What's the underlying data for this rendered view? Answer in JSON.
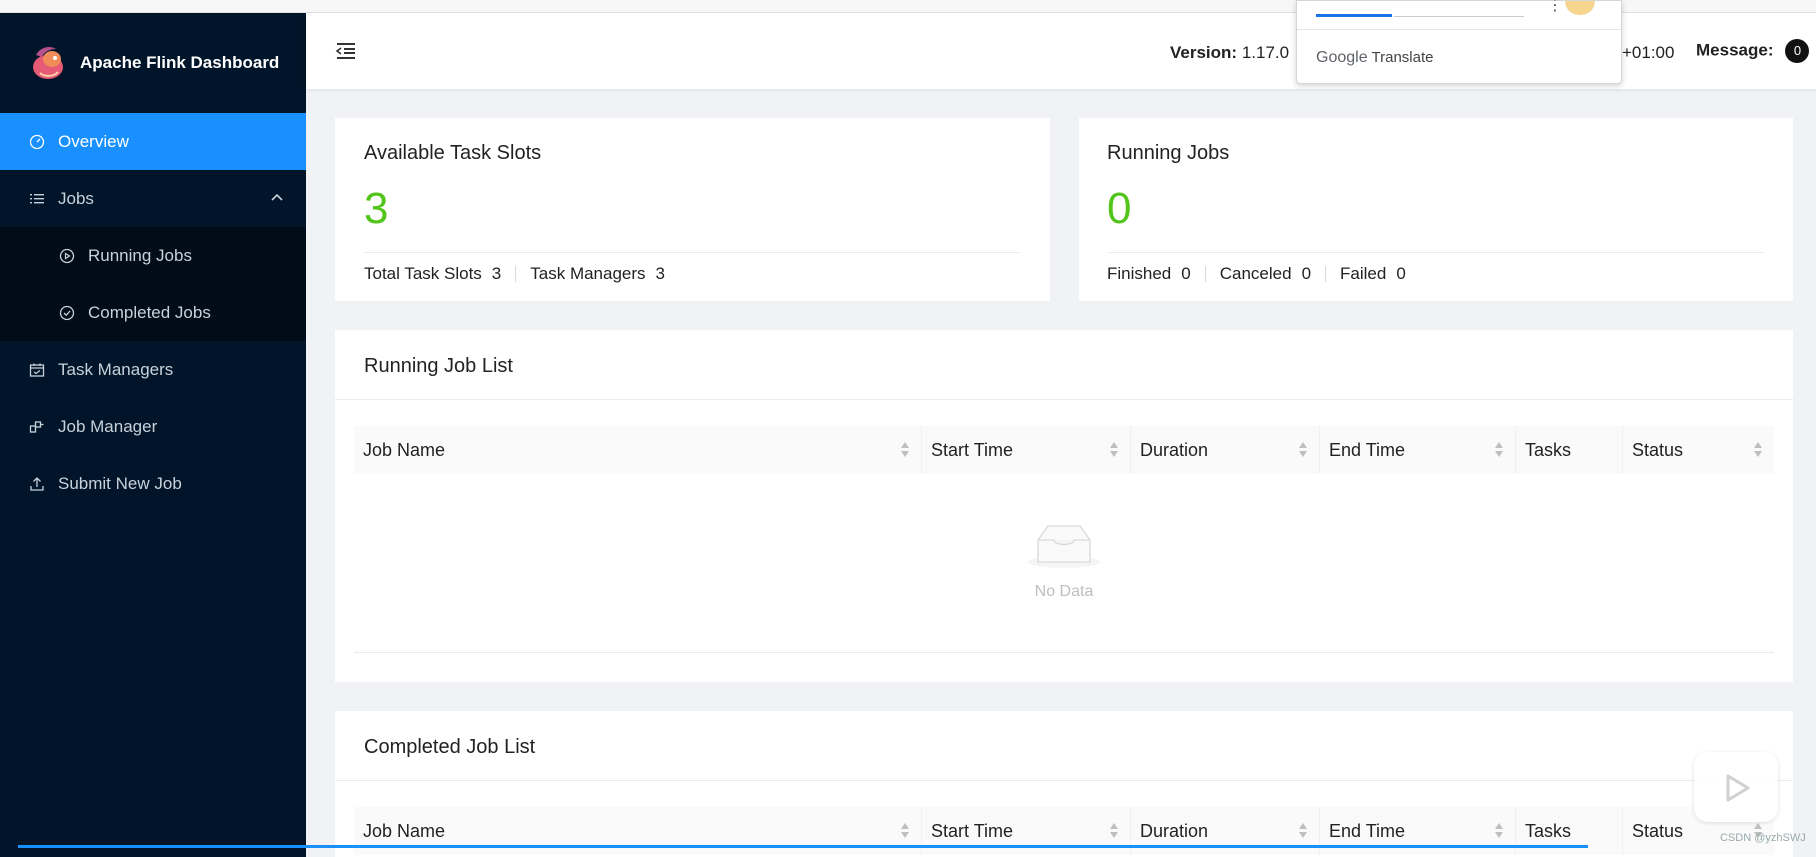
{
  "brand": {
    "title": "Apache Flink Dashboard"
  },
  "sidebar": {
    "items": [
      {
        "label": "Overview",
        "icon": "dashboard-icon",
        "active": true
      },
      {
        "label": "Jobs",
        "icon": "list-icon",
        "expanded": true
      },
      {
        "label": "Running Jobs",
        "icon": "play-circle-icon",
        "sub": true
      },
      {
        "label": "Completed Jobs",
        "icon": "check-circle-icon",
        "sub": true
      },
      {
        "label": "Task Managers",
        "icon": "schedule-icon"
      },
      {
        "label": "Job Manager",
        "icon": "cluster-icon"
      },
      {
        "label": "Submit New Job",
        "icon": "upload-icon"
      }
    ]
  },
  "header": {
    "version_label": "Version:",
    "version_value": "1.17.0",
    "timezone_fragment": "+01:00",
    "message_label": "Message:",
    "message_count": "0"
  },
  "translate_popup": {
    "brand_google": "Google",
    "brand_translate": "Translate"
  },
  "overview": {
    "slots_card": {
      "title": "Available Task Slots",
      "value": "3",
      "total_label": "Total Task Slots",
      "total_value": "3",
      "tm_label": "Task Managers",
      "tm_value": "3"
    },
    "jobs_card": {
      "title": "Running Jobs",
      "value": "0",
      "finished_label": "Finished",
      "finished_value": "0",
      "canceled_label": "Canceled",
      "canceled_value": "0",
      "failed_label": "Failed",
      "failed_value": "0"
    }
  },
  "running_list": {
    "title": "Running Job List",
    "columns": [
      "Job Name",
      "Start Time",
      "Duration",
      "End Time",
      "Tasks",
      "Status"
    ],
    "empty_text": "No Data"
  },
  "completed_list": {
    "title": "Completed Job List",
    "columns": [
      "Job Name",
      "Start Time",
      "Duration",
      "End Time",
      "Tasks",
      "Status"
    ]
  },
  "watermark": "CSDN @yzhSWJ",
  "colors": {
    "sidebar_bg": "#001529",
    "active": "#1890ff",
    "success": "#52c41a"
  }
}
